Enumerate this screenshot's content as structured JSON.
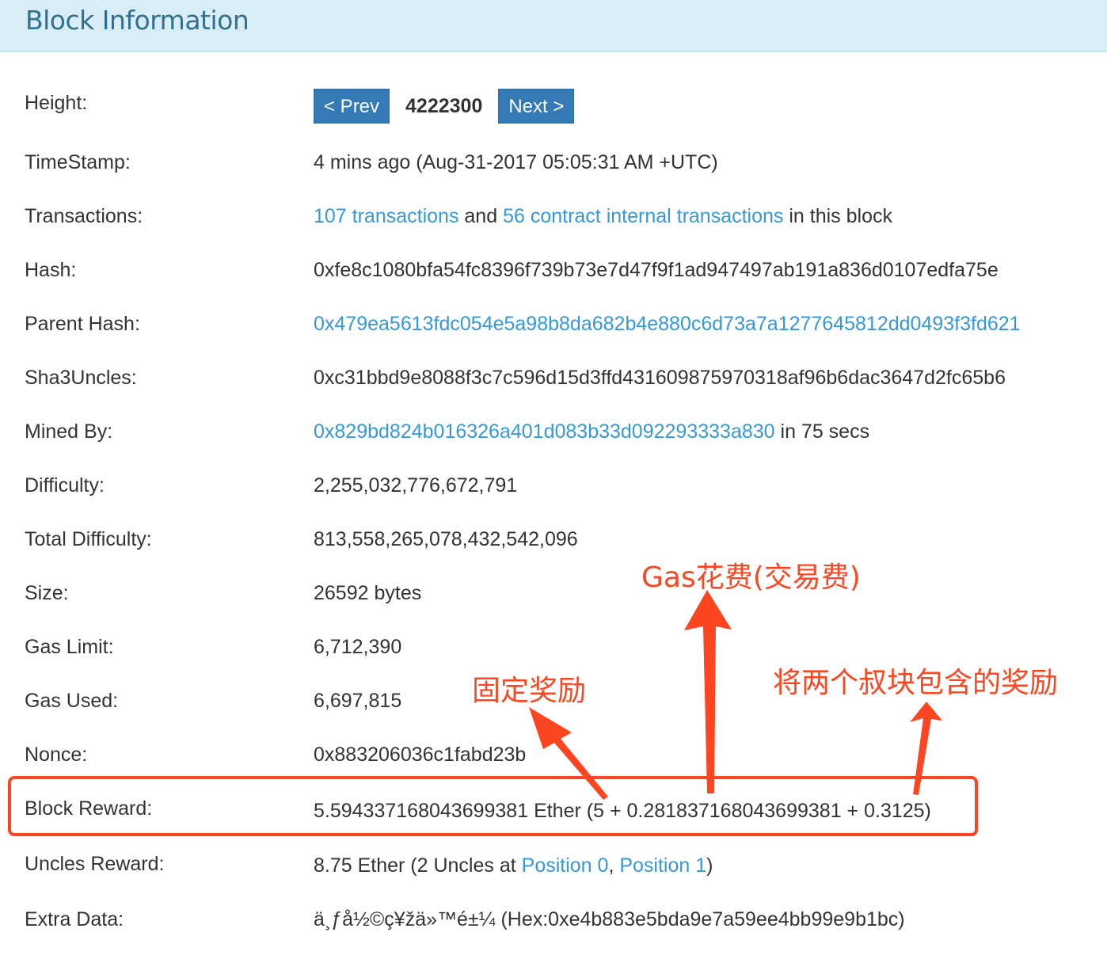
{
  "header": {
    "title": "Block Information"
  },
  "height": {
    "label": "Height:",
    "prev_label": "< Prev",
    "value": "4222300",
    "next_label": "Next >"
  },
  "timestamp": {
    "label": "TimeStamp:",
    "value": "4 mins ago (Aug-31-2017 05:05:31 AM +UTC)"
  },
  "transactions": {
    "label": "Transactions:",
    "tx_link": "107 transactions",
    "and_text": " and ",
    "internal_link": "56 contract internal transactions",
    "suffix": " in this block"
  },
  "hash": {
    "label": "Hash:",
    "value": "0xfe8c1080bfa54fc8396f739b73e7d47f9f1ad947497ab191a836d0107edfa75e"
  },
  "parent_hash": {
    "label": "Parent Hash:",
    "value": "0x479ea5613fdc054e5a98b8da682b4e880c6d73a7a1277645812dd0493f3fd621"
  },
  "sha3uncles": {
    "label": "Sha3Uncles:",
    "value": "0xc31bbd9e8088f3c7c596d15d3ffd431609875970318af96b6dac3647d2fc65b6"
  },
  "mined_by": {
    "label": "Mined By:",
    "address": "0x829bd824b016326a401d083b33d092293333a830",
    "suffix": " in 75 secs"
  },
  "difficulty": {
    "label": "Difficulty:",
    "value": "2,255,032,776,672,791"
  },
  "total_difficulty": {
    "label": "Total Difficulty:",
    "value": "813,558,265,078,432,542,096"
  },
  "size": {
    "label": "Size:",
    "value": "26592 bytes"
  },
  "gas_limit": {
    "label": "Gas Limit:",
    "value": "6,712,390"
  },
  "gas_used": {
    "label": "Gas Used:",
    "value": "6,697,815"
  },
  "nonce": {
    "label": "Nonce:",
    "value": "0x883206036c1fabd23b"
  },
  "block_reward": {
    "label": "Block Reward:",
    "value": "5.594337168043699381 Ether (5 + 0.281837168043699381 + 0.3125)"
  },
  "uncles_reward": {
    "label": "Uncles Reward:",
    "prefix": "8.75 Ether (2 Uncles at ",
    "pos0": "Position 0",
    "sep": ", ",
    "pos1": "Position 1",
    "suffix": ")"
  },
  "extra_data": {
    "label": "Extra Data:",
    "value": "ä¸ƒå½©ç¥žä»™é±¼ (Hex:0xe4b883e5bda9e7a59ee4bb99e9b1bc)"
  },
  "annotations": {
    "fixed_reward": "固定奖励",
    "gas_fee": "Gas花费(交易费)",
    "uncle_reward": "将两个叔块包含的奖励",
    "color": "#fc4621"
  },
  "colors": {
    "link": "#3498db",
    "button": "#337ab7",
    "header_bg": "#d9edf7",
    "header_text": "#31708f"
  }
}
